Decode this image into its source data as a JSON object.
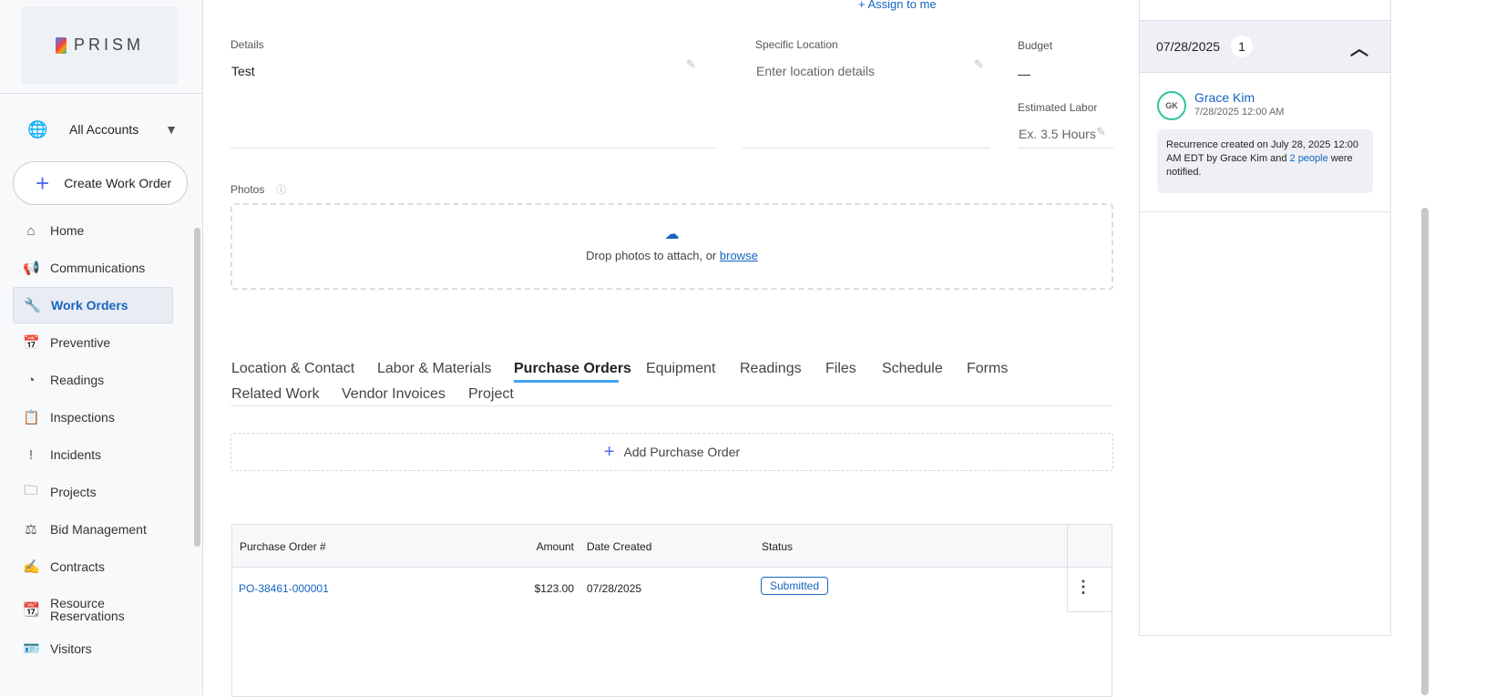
{
  "brand": {
    "name": "PRISM"
  },
  "sidebar": {
    "account": "All Accounts",
    "create_label": "Create Work Order",
    "items": [
      {
        "label": "Home",
        "icon": "⌂"
      },
      {
        "label": "Communications",
        "icon": "📢"
      },
      {
        "label": "Work Orders",
        "icon": "🔧"
      },
      {
        "label": "Preventive",
        "icon": "📅"
      },
      {
        "label": "Readings",
        "icon": "◔"
      },
      {
        "label": "Inspections",
        "icon": "📋"
      },
      {
        "label": "Incidents",
        "icon": "!"
      },
      {
        "label": "Projects",
        "icon": "🗀"
      },
      {
        "label": "Bid Management",
        "icon": "⚖"
      },
      {
        "label": "Contracts",
        "icon": "✍"
      },
      {
        "label": "Resource Reservations",
        "icon": "📆"
      },
      {
        "label": "Visitors",
        "icon": "🪪"
      }
    ]
  },
  "main": {
    "assign_label": "Assign to me",
    "details": {
      "label": "Details",
      "value": "Test"
    },
    "location": {
      "label": "Specific Location",
      "placeholder": "Enter location details"
    },
    "budget": {
      "label": "Budget",
      "value": "—"
    },
    "labor": {
      "label": "Estimated Labor",
      "placeholder": "Ex. 3.5 Hours"
    },
    "photos": {
      "label": "Photos",
      "drop_text": "Drop photos to attach, or",
      "browse": "browse"
    },
    "tabs": [
      "Location & Contact",
      "Labor & Materials",
      "Purchase Orders",
      "Equipment",
      "Readings",
      "Files",
      "Schedule",
      "Forms",
      "Related Work",
      "Vendor Invoices",
      "Project"
    ],
    "add_po": "Add Purchase Order",
    "table": {
      "headers": [
        "Purchase Order #",
        "Amount",
        "Date Created",
        "Status"
      ],
      "rows": [
        {
          "po": "PO-38461-000001",
          "amount": "$123.00",
          "date": "07/28/2025",
          "status": "Submitted"
        }
      ]
    }
  },
  "activity": {
    "date": "07/28/2025",
    "count": "1",
    "user": "Grace Kim",
    "initials": "GK",
    "time": "7/28/2025 12:00 AM",
    "note_pre": "Recurrence created on July 28, 2025 12:00 AM EDT by Grace Kim and",
    "note_link": "2 people",
    "note_post": "were notified."
  },
  "colors": {
    "accent": "#1565c0",
    "active_tab_underline": "#42a5f5"
  }
}
